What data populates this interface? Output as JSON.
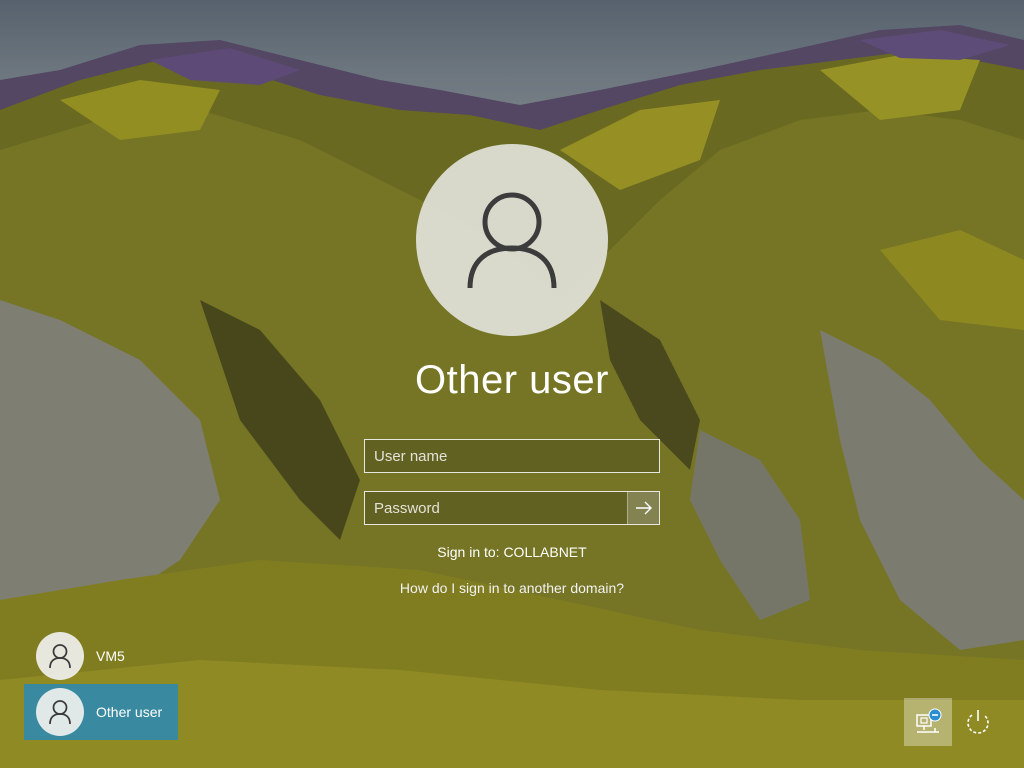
{
  "signin": {
    "user_title": "Other user",
    "username_placeholder": "User name",
    "password_placeholder": "Password",
    "submit_icon": "arrow-right-icon",
    "sign_in_to": "Sign in to: COLLABNET",
    "domain_help_link": "How do I sign in to another domain?"
  },
  "user_list": [
    {
      "name": "VM5",
      "selected": false,
      "icon": "user-avatar-icon"
    },
    {
      "name": "Other user",
      "selected": true,
      "icon": "user-avatar-icon"
    }
  ],
  "system_tray": {
    "network_icon": "network-icon",
    "power_icon": "power-icon"
  },
  "colors": {
    "selected_user_bg": "#208ac4",
    "text": "#ffffff"
  }
}
